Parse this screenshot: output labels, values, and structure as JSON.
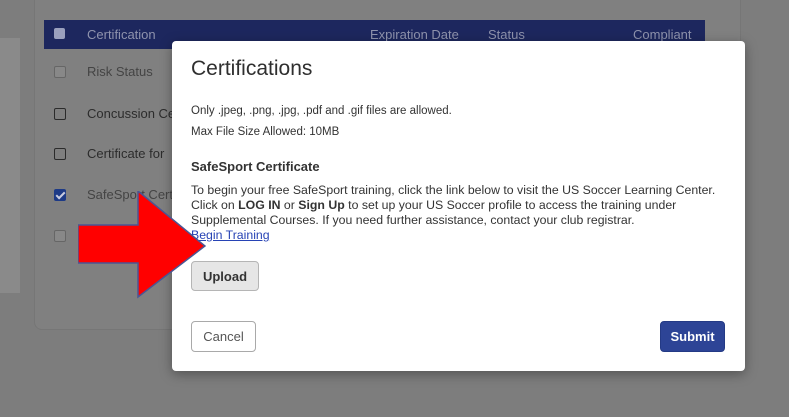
{
  "background": {
    "table_header": {
      "certification": "Certification",
      "expiration_date": "Expiration Date",
      "status": "Status",
      "compliant": "Compliant"
    },
    "rows": [
      {
        "label": "Risk Status"
      },
      {
        "label": "Concussion Ce"
      },
      {
        "label": "Certificate for"
      },
      {
        "label": "SafeSport Cert"
      }
    ]
  },
  "modal": {
    "title": "Certifications",
    "allowed_files": "Only .jpeg, .png, .jpg, .pdf and .gif files are allowed.",
    "max_size": "Max File Size Allowed: 10MB",
    "section_title": "SafeSport Certificate",
    "description": {
      "part1": "To begin your free SafeSport training, click the link below to visit the US Soccer Learning Center. Click on ",
      "login": "LOG IN",
      "part2": " or ",
      "signup": "Sign Up",
      "part3": " to set up your US Soccer profile to access the training under Supplemental Courses. If you need further assistance, contact your club registrar."
    },
    "link_label": "Begin Training",
    "upload_label": "Upload",
    "cancel_label": "Cancel",
    "submit_label": "Submit"
  },
  "colors": {
    "header_navy": "#1d275e",
    "submit_blue": "#2d4496",
    "link_blue": "#2743b5",
    "arrow_red": "#ff0000"
  }
}
